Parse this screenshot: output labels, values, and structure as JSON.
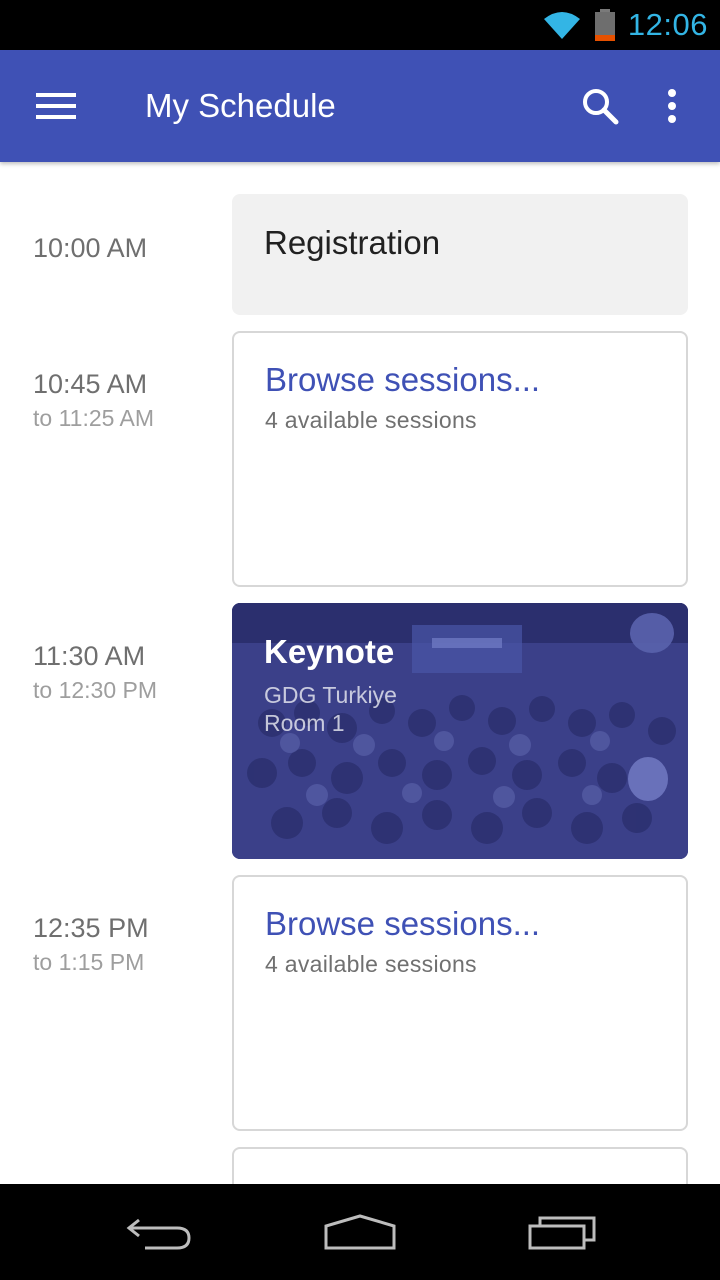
{
  "status_bar": {
    "time": "12:06",
    "wifi_icon": "wifi-icon",
    "battery_icon": "battery-icon",
    "accent": "#33b5e5"
  },
  "app_bar": {
    "title": "My Schedule",
    "menu_icon": "menu-icon",
    "search_icon": "search-icon",
    "overflow_icon": "more-vert-icon",
    "color": "#3f51b5"
  },
  "schedule": [
    {
      "start": "10:00 AM",
      "end": "",
      "title": "Registration",
      "kind": "plain"
    },
    {
      "start": "10:45 AM",
      "end": "to 11:25 AM",
      "title": "Browse sessions...",
      "subtitle": "4 available sessions",
      "kind": "browse"
    },
    {
      "start": "11:30 AM",
      "end": "to 12:30 PM",
      "title": "Keynote",
      "subtitle": "GDG Turkiye",
      "room": "Room 1",
      "kind": "session"
    },
    {
      "start": "12:35 PM",
      "end": "to 1:15 PM",
      "title": "Browse sessions...",
      "subtitle": "4 available sessions",
      "kind": "browse"
    }
  ],
  "nav_bar": {
    "back_icon": "back-icon",
    "home_icon": "home-icon",
    "recents_icon": "recents-icon"
  }
}
